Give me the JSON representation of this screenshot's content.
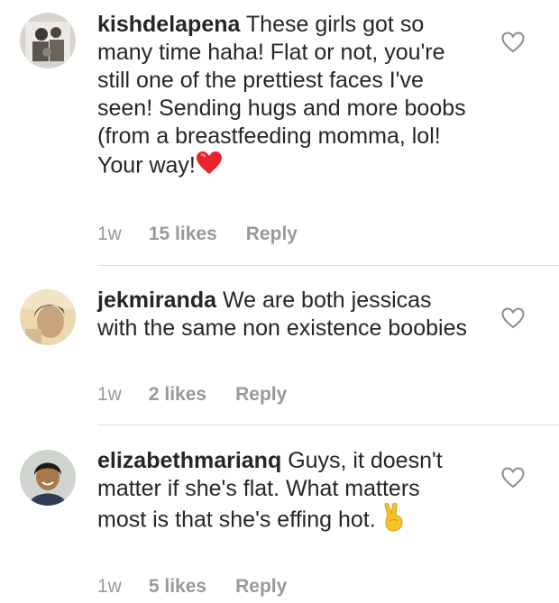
{
  "comments": [
    {
      "username": "kishdelapena",
      "text": "These girls got so many time haha! Flat or not, you're still one of the prettiest faces I've seen! Sending hugs and more boobs (from a breastfeeding momma, lol! Your way!",
      "emoji": "red-heart",
      "time": "1w",
      "likes": "15 likes",
      "reply": "Reply"
    },
    {
      "username": "jekmiranda",
      "text": "We are both jessicas with the same non existence boobies",
      "time": "1w",
      "likes": "2 likes",
      "reply": "Reply"
    },
    {
      "username": "elizabethmarianq",
      "text": "Guys, it doesn't matter if she's flat. What matters most is that she's effing hot.",
      "emoji": "victory-hand",
      "time": "1w",
      "likes": "5 likes",
      "reply": "Reply"
    }
  ],
  "colors": {
    "text": "#262626",
    "meta": "#999999",
    "divider": "#dbdbdb",
    "heart_emoji": "#e8242e"
  }
}
